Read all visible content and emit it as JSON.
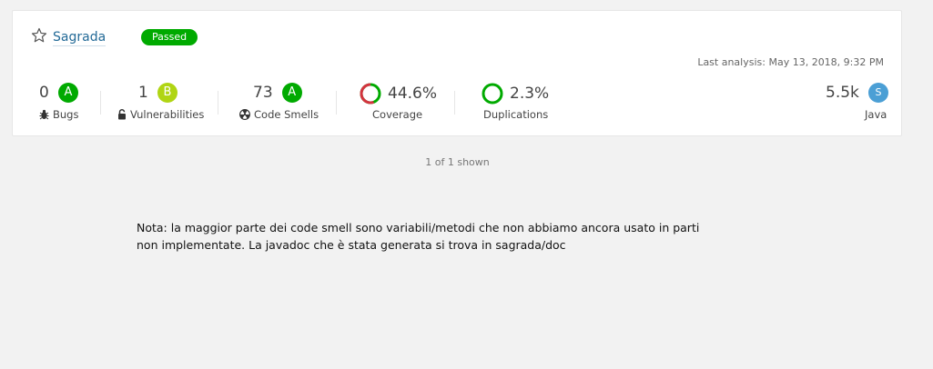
{
  "project": {
    "name": "Sagrada",
    "quality_gate": "Passed",
    "last_analysis": "Last analysis: May 13, 2018, 9:32 PM"
  },
  "metrics": {
    "bugs": {
      "value": "0",
      "rating": "A",
      "label": "Bugs",
      "rating_color": "#00aa00",
      "icon": "bug-icon"
    },
    "vulnerabilities": {
      "value": "1",
      "rating": "B",
      "label": "Vulnerabilities",
      "rating_color": "#b0d513",
      "icon": "lock-icon"
    },
    "code_smells": {
      "value": "73",
      "rating": "A",
      "label": "Code Smells",
      "rating_color": "#00aa00",
      "icon": "radioactive-icon"
    },
    "coverage": {
      "value": "44.6%",
      "label": "Coverage",
      "ring_color": "#d4333f"
    },
    "duplications": {
      "value": "2.3%",
      "label": "Duplications",
      "ring_color": "#00aa00"
    },
    "size": {
      "value": "5.5k",
      "language_badge": "S",
      "label": "Java",
      "badge_color": "#4b9fd5"
    }
  },
  "pagination": {
    "text": "1 of 1 shown"
  },
  "note": {
    "line1": "Nota: la maggior parte dei code smell sono variabili/metodi che non abbiamo ancora usato in parti",
    "line2": "non implementate. La javadoc che è stata generata si trova in sagrada/doc"
  }
}
